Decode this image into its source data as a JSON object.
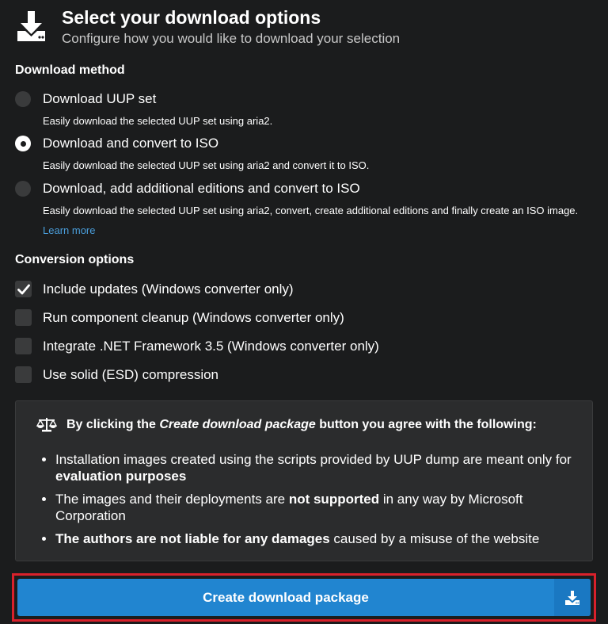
{
  "header": {
    "title": "Select your download options",
    "subtitle": "Configure how you would like to download your selection",
    "icon": "download-icon"
  },
  "download_method": {
    "title": "Download method",
    "options": [
      {
        "label": "Download UUP set",
        "description": "Easily download the selected UUP set using aria2.",
        "checked": false
      },
      {
        "label": "Download and convert to ISO",
        "description": "Easily download the selected UUP set using aria2 and convert it to ISO.",
        "checked": true
      },
      {
        "label": "Download, add additional editions and convert to ISO",
        "description": "Easily download the selected UUP set using aria2, convert, create additional editions and finally create an ISO image.",
        "link": "Learn more",
        "checked": false
      }
    ]
  },
  "conversion": {
    "title": "Conversion options",
    "options": [
      {
        "label": "Include updates (Windows converter only)",
        "checked": true
      },
      {
        "label": "Run component cleanup (Windows converter only)",
        "checked": false
      },
      {
        "label": "Integrate .NET Framework 3.5 (Windows converter only)",
        "checked": false
      },
      {
        "label": "Use solid (ESD) compression",
        "checked": false
      }
    ]
  },
  "notice": {
    "icon": "balance-scale-icon",
    "head_prefix": "By clicking the ",
    "head_em": "Create download package",
    "head_suffix": " button you agree with the following:",
    "items": [
      {
        "pre": "Installation images created using the scripts provided by UUP dump are meant only for ",
        "bold": "evaluation purposes",
        "post": ""
      },
      {
        "pre": "The images and their deployments are ",
        "bold": "not supported",
        "post": " in any way by Microsoft Corporation"
      },
      {
        "pre": "",
        "bold": "The authors are not liable for any damages",
        "post": " caused by a misuse of the website"
      }
    ]
  },
  "button": {
    "label": "Create download package",
    "icon": "download-icon"
  },
  "colors": {
    "background": "#1b1c1d",
    "primary": "#2185d0",
    "highlight_border": "#d9212b",
    "link": "#4a9edb"
  }
}
